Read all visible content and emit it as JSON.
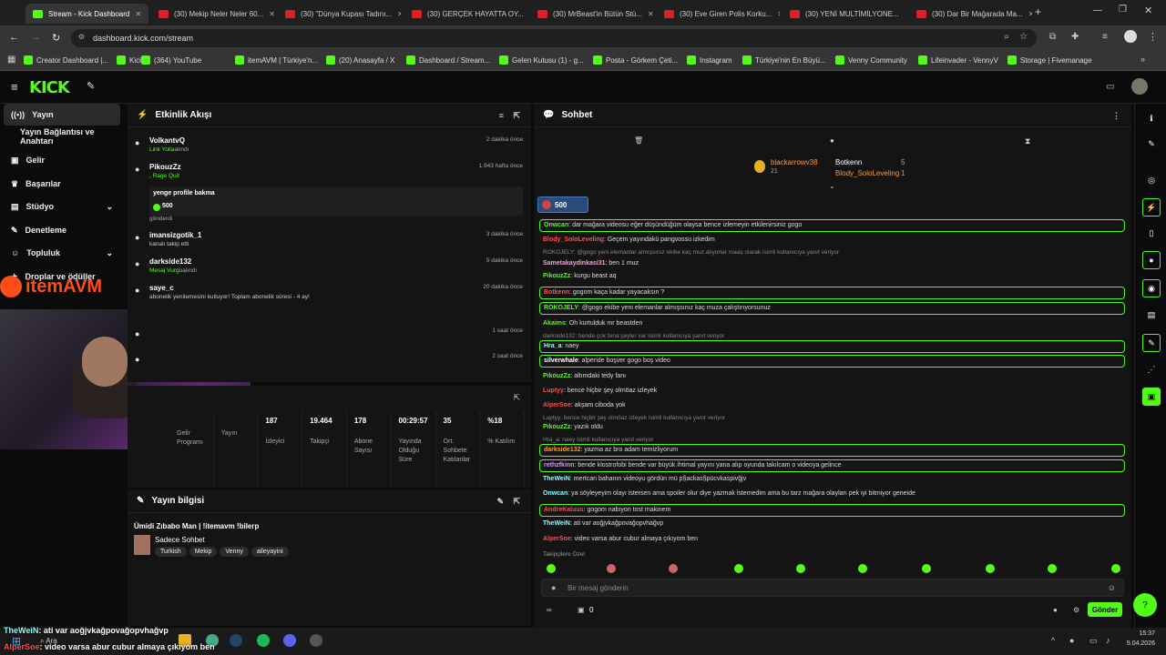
{
  "browser": {
    "tabs": [
      {
        "label": "Stream - Kick Dashboard",
        "active": true
      },
      {
        "label": "(30) Mekip Neler Neler 60..."
      },
      {
        "label": "(30) \"Dünya Kupası Tadını..."
      },
      {
        "label": "(30) GERÇEK HAYATTA OY..."
      },
      {
        "label": "(30) MrBeast'in Bütün Stü..."
      },
      {
        "label": "(30) Eve Giren Polis Korku..."
      },
      {
        "label": "(30) YENİ MULTİMİLYONE..."
      },
      {
        "label": "(30) Dar Bir Mağarada Ma..."
      }
    ],
    "url": "dashboard.kick.com/stream",
    "bookmarks": [
      "Creator Dashboard |...",
      "Kick",
      "(364) YouTube",
      "itemAVM | Türkiye'n...",
      "(20) Anasayfa / X",
      "Dashboard / Stream...",
      "Gelen Kutusu (1) - g...",
      "Posta - Görkem Çeti...",
      "Instagram",
      "Türkiye'nin En Büyü...",
      "Venny Community",
      "Lifeinvader - VennyV",
      "Storage | Fivemanage"
    ]
  },
  "sidebar": {
    "items": [
      "Yayın",
      "Yayın Bağlantısı ve Anahtarı",
      "Gelir",
      "Başarılar",
      "Stüdyo",
      "Denetleme",
      "Topluluk",
      "Droplar ve ödüller"
    ]
  },
  "activity": {
    "title": "Etkinlik Akışı",
    "items": [
      {
        "user": "VolkantvQ",
        "sub": "Link Yolla",
        "suffix": "alındı",
        "time": "2 dakika önce"
      },
      {
        "user": "PikouzZz",
        "sub": ", Rage Quit",
        "time": "1.943 hafta önce",
        "note": "yenge profile bakma",
        "amount": "500",
        "after": "gönderdi"
      },
      {
        "user": "imansizgotik_1",
        "sub": "kanalı takip etti",
        "time": "3 dakika önce"
      },
      {
        "user": "darkside132",
        "sub": "Mesaj Vurgu",
        "suffix": "alındı",
        "time": "5 dakika önce"
      },
      {
        "user": "saye_c",
        "sub": "abonelik yenilemesini kutluyor! Toplam abonelik süresi - 4 ay!",
        "time": "20 dakika önce"
      },
      {
        "time": "1 saat önce"
      },
      {
        "time": "2 saat önce"
      }
    ]
  },
  "stats": [
    {
      "v": "",
      "l": "Gelir Programı"
    },
    {
      "v": "",
      "l": "Yayın"
    },
    {
      "v": "187",
      "l": "İzleyici"
    },
    {
      "v": "19.464",
      "l": "Takipçi"
    },
    {
      "v": "178",
      "l": "Abone Sayısı"
    },
    {
      "v": "00:29:57",
      "l": "Yayında Olduğu Süre"
    },
    {
      "v": "35",
      "l": "Ort. Sohbete Katılanlar"
    },
    {
      "v": "%18",
      "l": "% Katılım"
    }
  ],
  "info": {
    "title": "Yayın bilgisi",
    "stream_title": "Ümidi Zıbabo Man | !itemavm !bilerp",
    "category": "Sadece Sohbet",
    "tags": [
      "Turkish",
      "Mekip",
      "Venny",
      "aileyayini"
    ]
  },
  "chat": {
    "title": "Sohbet",
    "top": [
      {
        "n": "blackarrowv38",
        "c": "21"
      },
      {
        "n": "Botkenn",
        "c": "5"
      },
      {
        "n": "Blody_SoloLeveling",
        "c": "1"
      }
    ],
    "pinned_amount": "500",
    "messages": [
      {
        "u": "Onwcan",
        "c": "#53fc18",
        "t": ": dar mağara videosu eğer düşündüğüm olaysa bence izlemeyin etkilenirsiniz gogo",
        "hl": true
      },
      {
        "u": "Blody_SoloLeveling",
        "c": "#ff4d4d",
        "t": ": Geçem yayındakü pangvossu izkedim"
      },
      {
        "reply": "ROKOJELY: @gogo yeni elemanlar almışsınız ekibe kaç muz alıyorlar maaş olarak isimli kullanıcıya yanıt veriyor"
      },
      {
        "u": "Sametakaydinkasi31",
        "c": "#ff9ad5",
        "t": ": ben 1 muz"
      },
      {
        "u": "PikouzZz",
        "c": "#53fc18",
        "t": ": kurgu beast aq"
      },
      {
        "u": "Botkenn",
        "c": "#ff4d4d",
        "t": ": gogom kaça kadar yayacaksın ?",
        "hl": true
      },
      {
        "u": "ROKOJELY",
        "c": "#53fc18",
        "t": ": @gogo ekibe yeni elemanlar almışsınız kaç muza çalıştırıyorsunuz",
        "hl": true
      },
      {
        "u": "Akaims",
        "c": "#53fc18",
        "t": ": Oh kurtulduk mr beastden"
      },
      {
        "reply": "darkside132: bende çok fena şeyler var isimli kullanıcıya yanıt veriyor"
      },
      {
        "u": "Hra_a",
        "c": "#8ff",
        "t": ": naey",
        "hl": true
      },
      {
        "u": "silverwhale",
        "c": "#fff",
        "t": ": alperide boşver gogo boş video",
        "hl": true
      },
      {
        "u": "PikouzZz",
        "c": "#53fc18",
        "t": ": altımdaki tedy fanı"
      },
      {
        "u": "Luptyy",
        "c": "#ff4d4d",
        "t": ": bence hiçbir şey olmöaz izleyek"
      },
      {
        "u": "AlperSoe",
        "c": "#ff4d4d",
        "t": ": akşam ciboda yok"
      },
      {
        "reply": "Luptyy: bence hiçbir şey olmöaz izleyek isimli kullanıcıya yanıt veriyor"
      },
      {
        "u": "PikouzZz",
        "c": "#53fc18",
        "t": ": yazık oldu"
      },
      {
        "reply": "Hra_a: naey isimli kullanıcıya yanıt veriyor"
      },
      {
        "u": "darkside132",
        "c": "#ff9933",
        "t": ": yazma az bro adam temizliyorum",
        "hl": true
      },
      {
        "u": "rethzfkinn",
        "c": "#c9f",
        "t": ": bende klostrofobi bende var büyük ihtimal yayını yana alıp oyunda takılcam o videoya gelince",
        "hl": true
      },
      {
        "u": "TheWeiN",
        "c": "#8ff",
        "t": ": mertcan bahanın videoyu gördün mü p§ackas§pücvkaspivğjv"
      },
      {
        "u": "Onwcan",
        "c": "#8ff",
        "t": ": ya söyleyeyim olayı istersen ama spoiler olur diye yazmak istemedim ama bu tarz mağara olayları pek iyi bitmiyor geneide"
      },
      {
        "u": "AndreKaluus",
        "c": "#ff4d4d",
        "t": ": gogom nabıyon tost makinem",
        "hl": true
      },
      {
        "u": "TheWeiN",
        "c": "#8ff",
        "t": ": ati var aoğjvkağpovağopvhağvp"
      },
      {
        "u": "AlperSoe",
        "c": "#ff4d4d",
        "t": ": video varsa abur cubur almaya çıkıyom ben"
      }
    ],
    "followers_only": "Takipçilere Özel",
    "placeholder": "Bir mesaj gönderin",
    "count": "0",
    "send": "Gönder"
  },
  "overlay": {
    "line1_user": "TheWeiN",
    "line1": ": ati var aoğjvkağpovağopvhağvp",
    "line2_user": "AlperSoe",
    "line2": ": video varsa abur cubur almaya çıkıyom ben",
    "brand": "itemAVM"
  },
  "taskbar": {
    "time": "15:37",
    "date": "5.04.2026",
    "search": "Ara"
  },
  "colors": {
    "accent": "#53fc18"
  }
}
